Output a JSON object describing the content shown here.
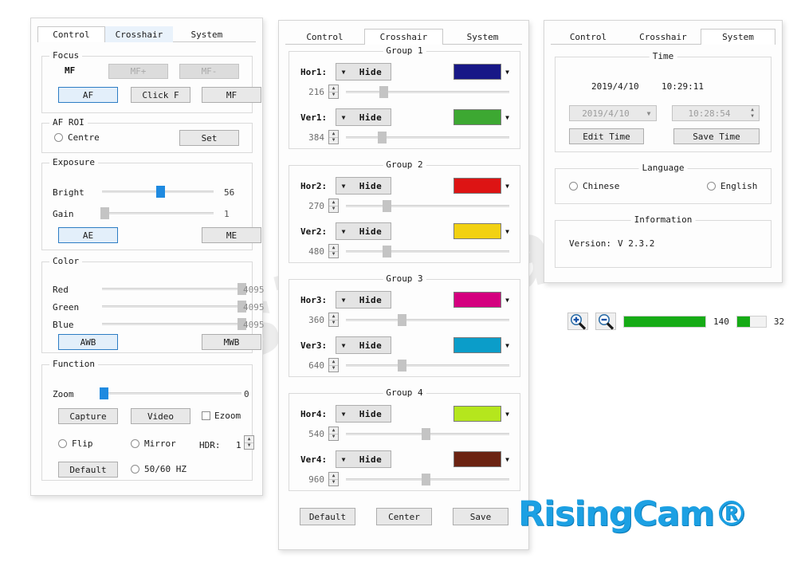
{
  "watermark": {
    "text": "RisingCam®"
  },
  "logo": {
    "text": "RisingCam®",
    "color": "#1CA0E3"
  },
  "tabs": {
    "control": "Control",
    "crosshair": "Crosshair",
    "system": "System"
  },
  "control_panel": {
    "focus": {
      "title": "Focus",
      "mode_label": "MF",
      "mf_plus": "MF+",
      "mf_minus": "MF-",
      "af": "AF",
      "click_f": "Click F",
      "mf": "MF"
    },
    "af_roi": {
      "title": "AF ROI",
      "centre": "Centre",
      "set": "Set"
    },
    "exposure": {
      "title": "Exposure",
      "bright_label": "Bright",
      "bright_value": "56",
      "bright_pct": 52,
      "gain_label": "Gain",
      "gain_value": "1",
      "gain_pct": 2,
      "ae": "AE",
      "me": "ME"
    },
    "color": {
      "title": "Color",
      "rows": [
        {
          "label": "Red",
          "value": "4095",
          "pct": 100
        },
        {
          "label": "Green",
          "value": "4095",
          "pct": 100
        },
        {
          "label": "Blue",
          "value": "4095",
          "pct": 100
        }
      ],
      "awb": "AWB",
      "mwb": "MWB"
    },
    "function": {
      "title": "Function",
      "zoom_label": "Zoom",
      "zoom_value": "0",
      "zoom_pct": 1,
      "capture": "Capture",
      "video": "Video",
      "ezoom": "Ezoom",
      "flip": "Flip",
      "mirror": "Mirror",
      "hdr_label": "HDR:",
      "hdr_value": "1",
      "default": "Default",
      "hz": "50/60 HZ"
    }
  },
  "crosshair_panel": {
    "groups": [
      {
        "title": "Group 1",
        "rows": [
          {
            "name": "Hor1:",
            "action": "Hide",
            "value": "216",
            "pct": 23,
            "color": "#181887"
          },
          {
            "name": "Ver1:",
            "action": "Hide",
            "value": "384",
            "pct": 22,
            "color": "#3da832"
          }
        ]
      },
      {
        "title": "Group 2",
        "rows": [
          {
            "name": "Hor2:",
            "action": "Hide",
            "value": "270",
            "pct": 25,
            "color": "#dd1414"
          },
          {
            "name": "Ver2:",
            "action": "Hide",
            "value": "480",
            "pct": 25,
            "color": "#f2d112"
          }
        ]
      },
      {
        "title": "Group 3",
        "rows": [
          {
            "name": "Hor3:",
            "action": "Hide",
            "value": "360",
            "pct": 34,
            "color": "#d4007f"
          },
          {
            "name": "Ver3:",
            "action": "Hide",
            "value": "640",
            "pct": 34,
            "color": "#0b9dc9"
          }
        ]
      },
      {
        "title": "Group 4",
        "rows": [
          {
            "name": "Hor4:",
            "action": "Hide",
            "value": "540",
            "pct": 49,
            "color": "#b5e61d"
          },
          {
            "name": "Ver4:",
            "action": "Hide",
            "value": "960",
            "pct": 49,
            "color": "#6b2312"
          }
        ]
      }
    ],
    "buttons": {
      "default": "Default",
      "center": "Center",
      "save": "Save"
    }
  },
  "system_panel": {
    "time": {
      "title": "Time",
      "current_date": "2019/4/10",
      "current_time": "10:29:11",
      "date_field": "2019/4/10",
      "time_field": "10:28:54",
      "edit_time": "Edit Time",
      "save_time": "Save Time"
    },
    "language": {
      "title": "Language",
      "chinese": "Chinese",
      "english": "English"
    },
    "information": {
      "title": "Information",
      "version_label": "Version:",
      "version_value": "V 2.3.2"
    }
  },
  "zoom_widget": {
    "zoom_in": "zoom-in",
    "zoom_out": "zoom-out",
    "bar1_value": "140",
    "bar1_pct": 100,
    "bar2_value": "32",
    "bar2_pct": 45,
    "bar_color": "#16ab16"
  }
}
